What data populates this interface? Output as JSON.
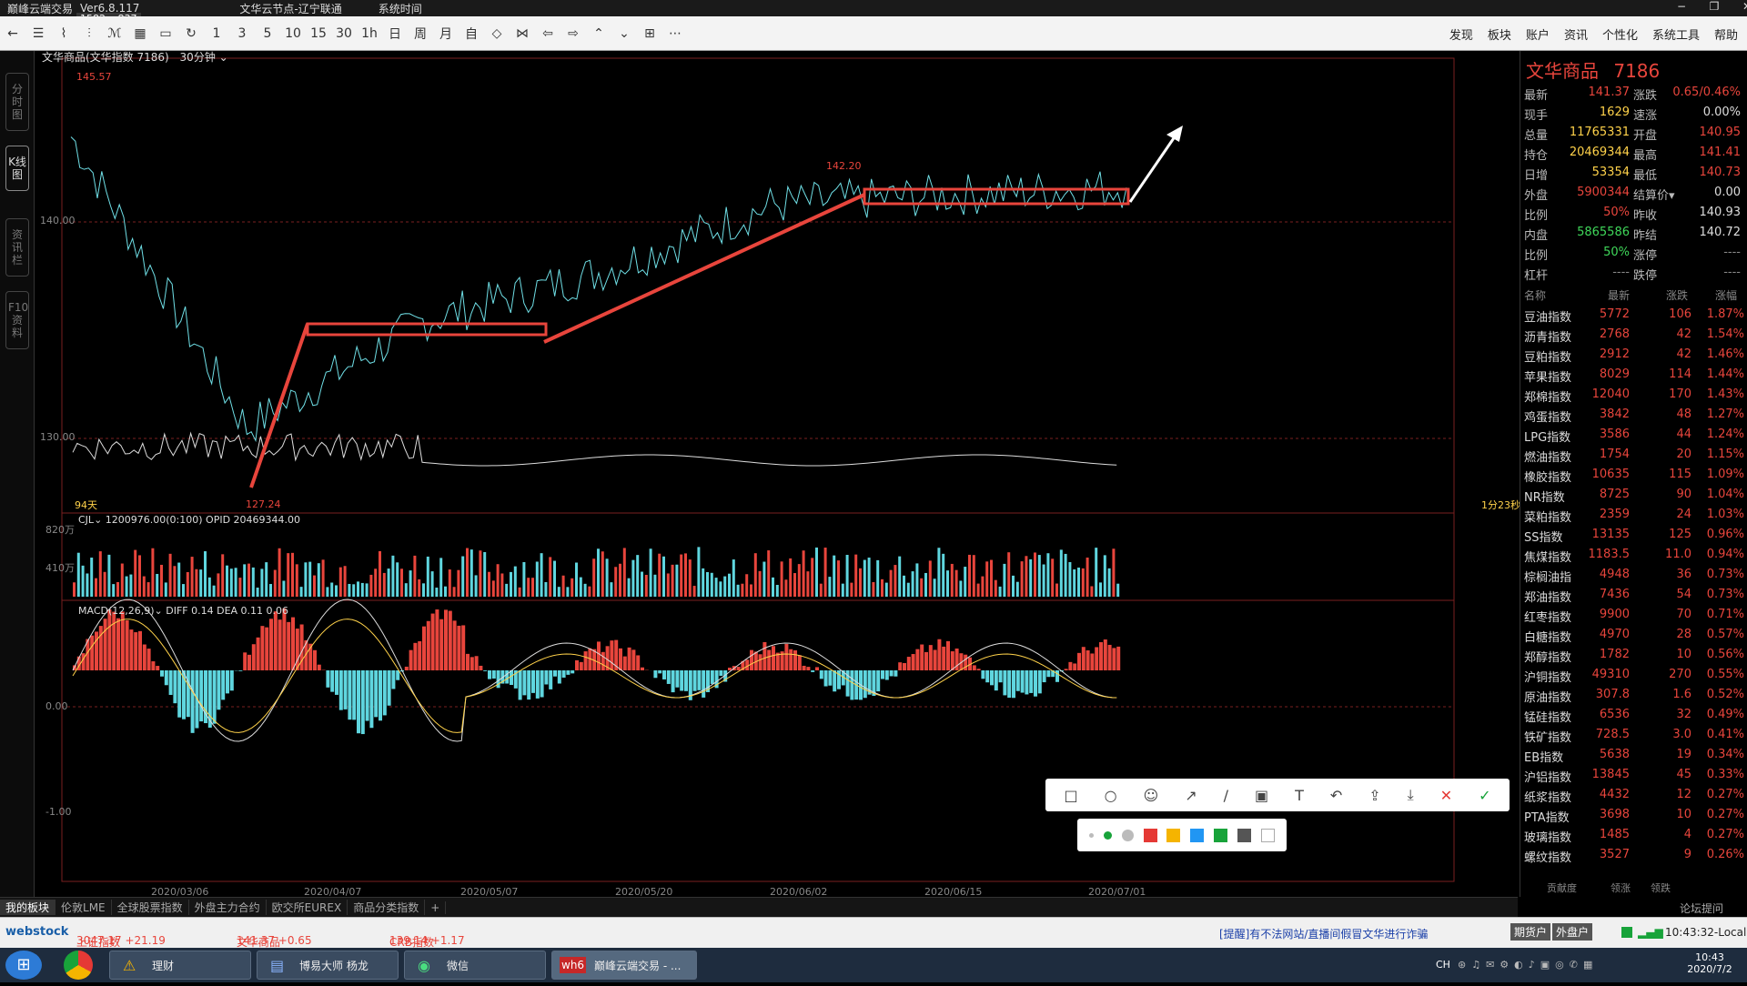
{
  "title": {
    "app": "巅峰云端交易",
    "version": "Ver6.8.117",
    "node": "文华云节点-辽宁联通",
    "time_label": "系统时间",
    "selection_size": "1582 x 837",
    "controls": [
      "−",
      "❐",
      "✕"
    ]
  },
  "toolbar": {
    "icons": [
      "back-icon",
      "list-icon",
      "line-icon",
      "kline-icon",
      "kline2-icon",
      "table-icon",
      "save-icon",
      "refresh-icon"
    ],
    "periods": [
      "1",
      "3",
      "5",
      "10",
      "15",
      "30",
      "1h",
      "日",
      "周",
      "月",
      "自"
    ],
    "nav_icons": [
      "diamond-icon",
      "hourglass-icon",
      "left-arrow-icon",
      "right-arrow-icon",
      "up-arrow-icon",
      "down-arrow-icon",
      "grid-icon",
      "more-icon"
    ],
    "right_menu": [
      "发现",
      "板块",
      "账户",
      "资讯",
      "个性化",
      "系统工具",
      "帮助"
    ]
  },
  "left_tabs": [
    "分时图",
    "K线图",
    "资讯栏",
    "F10资料"
  ],
  "chart": {
    "header": "文华商品(文华指数 7186)",
    "period": "30分钟",
    "high_label": "145.57",
    "low_label": "127.24",
    "mid_label": "142.20",
    "yticks": [
      "140.00",
      "130.00"
    ],
    "days_label": "94天",
    "countdown": "1分23秒",
    "volume_header": "CJL",
    "volume_values": "1200976.00(0:100)  OPID 20469344.00",
    "vol_ticks": [
      "820万",
      "410万"
    ],
    "macd_header": "MACD(12,26,9)",
    "macd_values": "DIFF 0.14  DEA 0.11  0.06",
    "macd_ticks": [
      "0.00",
      "-1.00"
    ],
    "dates": [
      "2020/03/06",
      "2020/04/07",
      "2020/05/07",
      "2020/05/20",
      "2020/06/02",
      "2020/06/15",
      "2020/07/01"
    ]
  },
  "chart_data": {
    "type": "line",
    "title": "文华商品(文华指数 7186)",
    "x": [
      "2020/03/06",
      "2020/04/07",
      "2020/05/07",
      "2020/05/20",
      "2020/06/02",
      "2020/06/15",
      "2020/07/01"
    ],
    "series": [
      {
        "values": [
          144.0,
          129.0,
          134.5,
          137.0,
          140.5,
          141.0,
          141.37
        ]
      }
    ],
    "ylim": [
      125,
      147
    ],
    "high": 145.57,
    "low": 127.24,
    "grid": true,
    "legend": "none"
  },
  "quote": {
    "name": "文华商品",
    "code": "7186",
    "rows": [
      {
        "l1": "最新",
        "v1": "141.37",
        "c1": "#e8453c",
        "l2": "涨跌",
        "v2": "0.65/0.46%",
        "c2": "#e8453c"
      },
      {
        "l1": "现手",
        "v1": "1629",
        "c1": "#ffd24a",
        "l2": "速涨",
        "v2": "0.00%",
        "c2": "#ddd"
      },
      {
        "l1": "总量",
        "v1": "11765331",
        "c1": "#ffd24a",
        "l2": "开盘",
        "v2": "140.95",
        "c2": "#e8453c"
      },
      {
        "l1": "持仓",
        "v1": "20469344",
        "c1": "#ffd24a",
        "l2": "最高",
        "v2": "141.41",
        "c2": "#e8453c"
      },
      {
        "l1": "日增",
        "v1": "53354",
        "c1": "#ffd24a",
        "l2": "最低",
        "v2": "140.73",
        "c2": "#e8453c"
      },
      {
        "l1": "外盘",
        "v1": "5900344",
        "c1": "#e8453c",
        "l2": "结算价▾",
        "v2": "0.00",
        "c2": "#ddd"
      },
      {
        "l1": "比例",
        "v1": "50%",
        "c1": "#e8453c",
        "l2": "昨收",
        "v2": "140.93",
        "c2": "#ddd"
      },
      {
        "l1": "内盘",
        "v1": "5865586",
        "c1": "#3fd85a",
        "l2": "昨结",
        "v2": "140.72",
        "c2": "#ddd"
      },
      {
        "l1": "比例",
        "v1": "50%",
        "c1": "#3fd85a",
        "l2": "涨停",
        "v2": "----",
        "c2": "#888"
      },
      {
        "l1": "杠杆",
        "v1": "----",
        "c1": "#888",
        "l2": "跌停",
        "v2": "----",
        "c2": "#888"
      }
    ]
  },
  "index_list": {
    "headers": [
      "名称",
      "最新",
      "涨跌",
      "涨幅"
    ],
    "rows": [
      [
        "豆油指数",
        "5772",
        "106",
        "1.87%"
      ],
      [
        "沥青指数",
        "2768",
        "42",
        "1.54%"
      ],
      [
        "豆粕指数",
        "2912",
        "42",
        "1.46%"
      ],
      [
        "苹果指数",
        "8029",
        "114",
        "1.44%"
      ],
      [
        "郑棉指数",
        "12040",
        "170",
        "1.43%"
      ],
      [
        "鸡蛋指数",
        "3842",
        "48",
        "1.27%"
      ],
      [
        "LPG指数",
        "3586",
        "44",
        "1.24%"
      ],
      [
        "燃油指数",
        "1754",
        "20",
        "1.15%"
      ],
      [
        "橡胶指数",
        "10635",
        "115",
        "1.09%"
      ],
      [
        "NR指数",
        "8725",
        "90",
        "1.04%"
      ],
      [
        "菜粕指数",
        "2359",
        "24",
        "1.03%"
      ],
      [
        "SS指数",
        "13135",
        "125",
        "0.96%"
      ],
      [
        "焦煤指数",
        "1183.5",
        "11.0",
        "0.94%"
      ],
      [
        "棕榈油指",
        "4948",
        "36",
        "0.73%"
      ],
      [
        "郑油指数",
        "7436",
        "54",
        "0.73%"
      ],
      [
        "红枣指数",
        "9900",
        "70",
        "0.71%"
      ],
      [
        "白糖指数",
        "4970",
        "28",
        "0.57%"
      ],
      [
        "郑醇指数",
        "1782",
        "10",
        "0.56%"
      ],
      [
        "沪铜指数",
        "49310",
        "270",
        "0.55%"
      ],
      [
        "原油指数",
        "307.8",
        "1.6",
        "0.52%"
      ],
      [
        "锰硅指数",
        "6536",
        "32",
        "0.49%"
      ],
      [
        "铁矿指数",
        "728.5",
        "3.0",
        "0.41%"
      ],
      [
        "EB指数",
        "5638",
        "19",
        "0.34%"
      ],
      [
        "沪铝指数",
        "13845",
        "45",
        "0.33%"
      ],
      [
        "纸浆指数",
        "4432",
        "12",
        "0.27%"
      ],
      [
        "PTA指数",
        "3698",
        "10",
        "0.27%"
      ],
      [
        "玻璃指数",
        "1485",
        "4",
        "0.27%"
      ],
      [
        "螺纹指数",
        "3527",
        "9",
        "0.26%"
      ]
    ],
    "footer": [
      "贡献度",
      "领涨",
      "领跌"
    ]
  },
  "draw_tools": [
    "rectangle-icon",
    "circle-icon",
    "emoji-icon",
    "arrow-icon",
    "pen-icon",
    "mosaic-icon",
    "text-icon",
    "undo-icon",
    "share-icon",
    "download-icon",
    "close-icon",
    "confirm-icon"
  ],
  "draw_glyphs": [
    "□",
    "○",
    "☺",
    "↗",
    "/",
    "▣",
    "T",
    "↶",
    "⇪",
    "⤓",
    "✕",
    "✓"
  ],
  "colors": [
    "#e53935",
    "#f5b400",
    "#2196f3",
    "#18a33a",
    "#555555",
    "#ffffff"
  ],
  "bottom_tabs": [
    "我的板块",
    "伦敦LME",
    "全球股票指数",
    "外盘主力合约",
    "欧交所EUREX",
    "商品分类指数",
    "+"
  ],
  "status": {
    "brand": "webstock",
    "items": [
      {
        "label": "上证指数",
        "value": "3047.17  +21.19"
      },
      {
        "label": "文华商品",
        "value": "141.37  +0.65"
      },
      {
        "label": "CRB指数",
        "value": "139.14  +1.17"
      }
    ],
    "notice": "[提醒]有不法网站/直播间假冒文华进行诈骗",
    "account": "期货户",
    "outer": "外盘户",
    "clock": "10:43:32-Local"
  },
  "taskbar": {
    "apps": [
      "理财",
      "博易大师 杨龙",
      "微信",
      "巅峰云端交易 - ..."
    ],
    "tray_lang": "CH",
    "time": "10:43",
    "date": "2020/7/2"
  },
  "watermark": "论坛提问"
}
